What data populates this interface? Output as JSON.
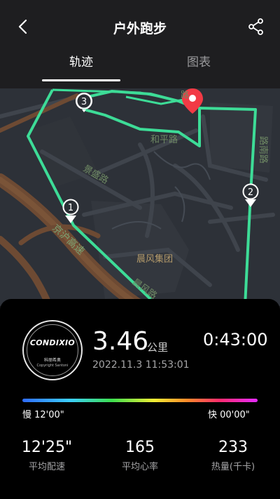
{
  "header": {
    "title": "户外跑步",
    "back_icon": "back-chevron-icon",
    "share_icon": "share-icon"
  },
  "tabs": [
    {
      "label": "轨迹",
      "active": true
    },
    {
      "label": "图表",
      "active": false
    }
  ],
  "map": {
    "labels": {
      "road1": "和平路",
      "road2": "景盛路",
      "road3": "京沪高速",
      "road4": "晨风集团",
      "road5": "晨风路",
      "road6": "路南路",
      "road7": "路"
    },
    "markers": [
      "1",
      "2",
      "3"
    ],
    "route_color": "#3ddc97",
    "pin_color": "#f23a45"
  },
  "summary": {
    "brand": "CONDIXIO",
    "brand_cn": "科丽希奥",
    "brand_copyright": "Copyright Santoni",
    "distance": "3.46",
    "distance_unit": "公里",
    "duration": "0:43:00",
    "datetime": "2022.11.3 11:53:01",
    "pace_slow": "慢 12'00\"",
    "pace_fast": "快 00'00\"",
    "stats": [
      {
        "value": "12'25\"",
        "label": "平均配速"
      },
      {
        "value": "165",
        "label": "平均心率"
      },
      {
        "value": "233",
        "label": "热量(千卡)"
      }
    ]
  }
}
